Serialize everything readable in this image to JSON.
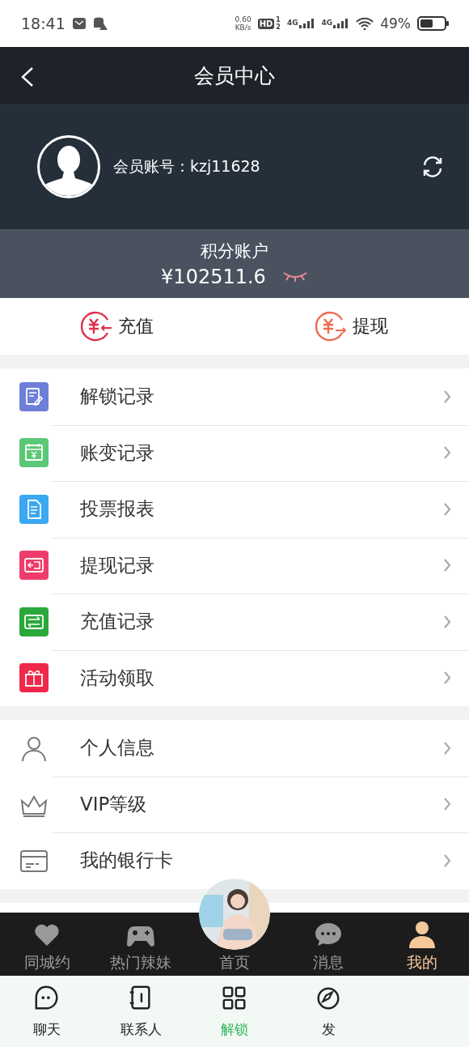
{
  "status_bar": {
    "time": "18:41",
    "net_speed": "0.60",
    "net_unit": "KB/s",
    "hd": "HD",
    "hd_sims": [
      "1",
      "2"
    ],
    "signals": [
      "4G",
      "4G"
    ],
    "battery": "49%"
  },
  "header": {
    "title": "会员中心"
  },
  "account": {
    "label": "会员账号：kzj11628"
  },
  "points": {
    "title": "积分账户",
    "balance": "¥102511.6"
  },
  "actions": [
    {
      "label": "充值",
      "color": "#e0304a"
    },
    {
      "label": "提现",
      "color": "#ef6a50"
    }
  ],
  "menu_groups": [
    {
      "kind": "colored",
      "items": [
        {
          "label": "解锁记录",
          "color": "#6d7fd8"
        },
        {
          "label": "账变记录",
          "color": "#5bc878"
        },
        {
          "label": "投票报表",
          "color": "#3aa8f2"
        },
        {
          "label": "提现记录",
          "color": "#f03c6a"
        },
        {
          "label": "充值记录",
          "color": "#2aa83a"
        },
        {
          "label": "活动领取",
          "color": "#f0284a"
        }
      ]
    },
    {
      "kind": "outline",
      "items": [
        {
          "label": "个人信息"
        },
        {
          "label": "VIP等级"
        },
        {
          "label": "我的银行卡"
        }
      ]
    }
  ],
  "tab_bar": [
    {
      "label": "同城约",
      "selected": false,
      "kind": "icon"
    },
    {
      "label": "热门辣妹",
      "selected": false,
      "kind": "icon"
    },
    {
      "label": "首页",
      "selected": false,
      "kind": "picture"
    },
    {
      "label": "消息",
      "selected": false,
      "kind": "icon"
    },
    {
      "label": "我的",
      "selected": true,
      "kind": "icon"
    }
  ],
  "bottom_nav": [
    {
      "label": "聊天",
      "selected": false
    },
    {
      "label": "联系人",
      "selected": false
    },
    {
      "label": "解锁",
      "selected": true
    },
    {
      "label": "发",
      "selected": false
    }
  ]
}
